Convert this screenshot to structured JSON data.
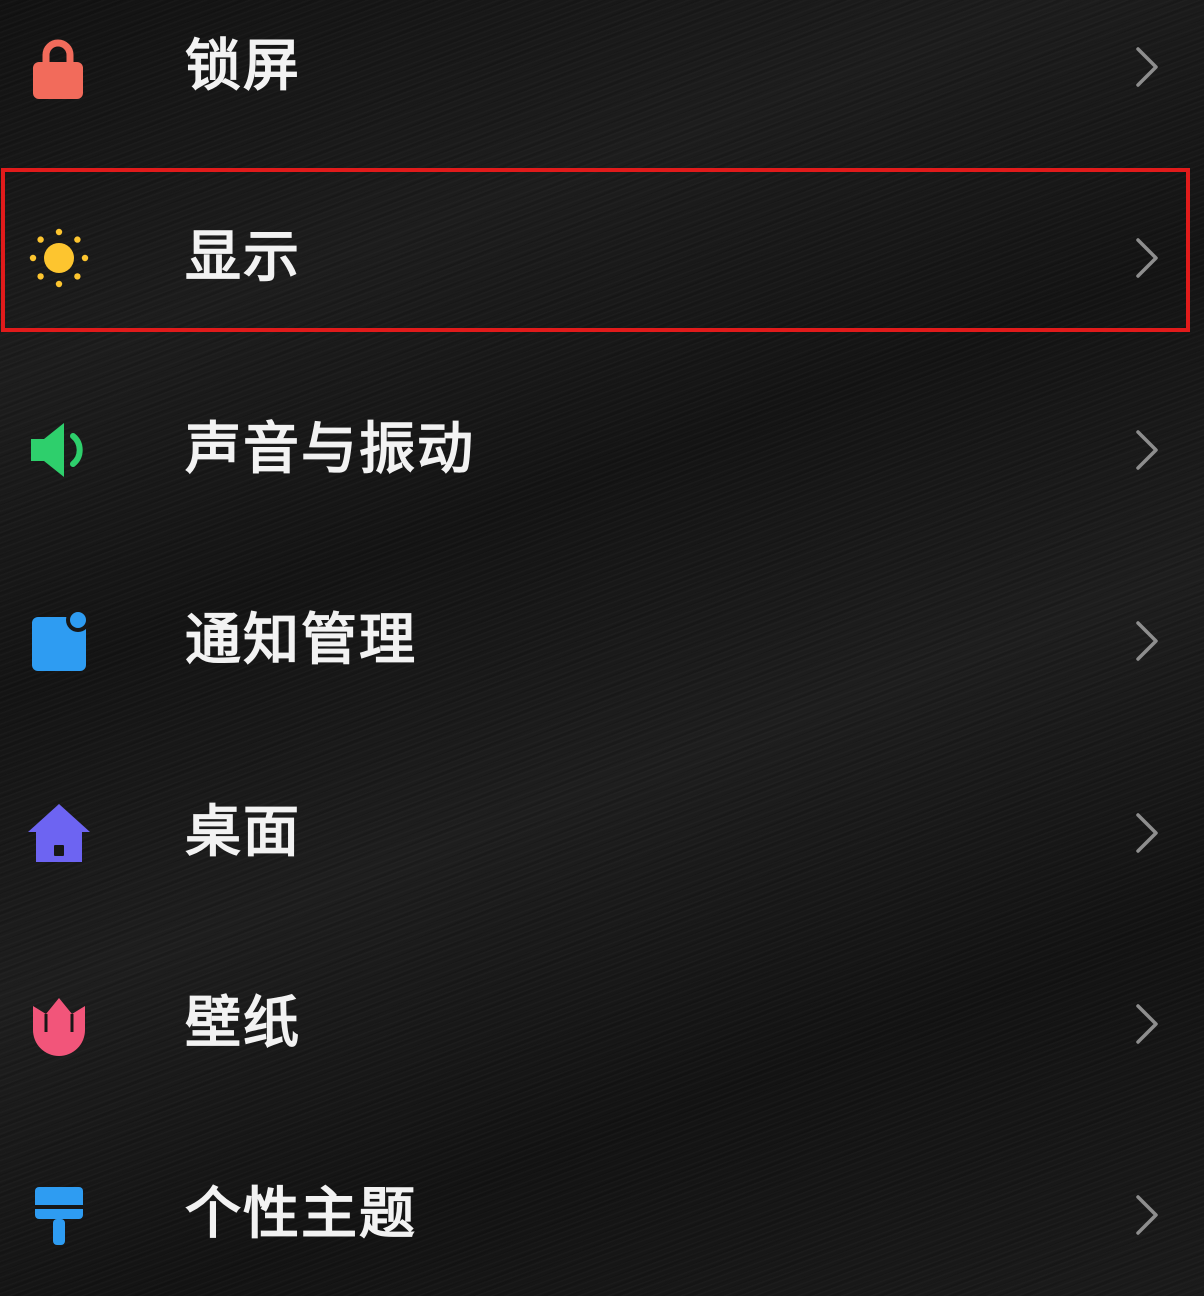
{
  "settings": {
    "items": [
      {
        "label": "锁屏",
        "icon": "lock-icon",
        "icon_color": "#f26b5b"
      },
      {
        "label": "显示",
        "icon": "sun-icon",
        "icon_color": "#fdc52f"
      },
      {
        "label": "声音与振动",
        "icon": "speaker-icon",
        "icon_color": "#2ecf6c"
      },
      {
        "label": "通知管理",
        "icon": "notification-icon",
        "icon_color": "#2e9cf2"
      },
      {
        "label": "桌面",
        "icon": "home-icon",
        "icon_color": "#6d64f2"
      },
      {
        "label": "壁纸",
        "icon": "tulip-icon",
        "icon_color": "#f2557a"
      },
      {
        "label": "个性主题",
        "icon": "brush-icon",
        "icon_color": "#2e9cf2"
      }
    ]
  },
  "highlight": {
    "item": "显示",
    "color": "#e11b1b"
  },
  "chevron_icon": "chevron-right-icon"
}
